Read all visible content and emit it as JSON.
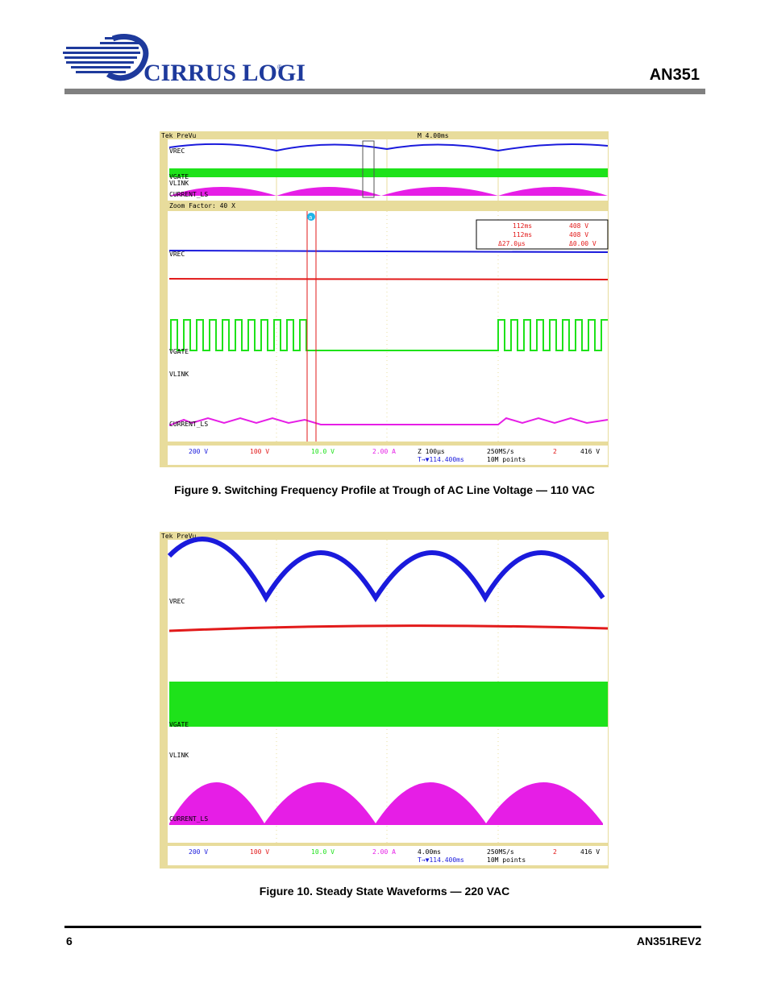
{
  "header": {
    "company": "CIRRUS LOGIC",
    "registered": "®",
    "doc_id": "AN351"
  },
  "figure9": {
    "caption": "Figure 9.  Switching Frequency Profile at Trough of AC Line Voltage — 110 VAC",
    "scope": {
      "top_left": "Tek PreVu",
      "timebase": "M 4.00ms",
      "zoom_factor": "Zoom Factor: 40 X",
      "channels": [
        "VREC",
        "VGATE",
        "VLINK",
        "CURRENT_LS"
      ],
      "cursor_label": "a",
      "readout": {
        "row1": [
          "112ms",
          "408 V"
        ],
        "row2": [
          "112ms",
          "408 V"
        ],
        "row3": [
          "Δ27.0µs",
          "Δ0.00 V"
        ]
      },
      "status": {
        "ch1": "200 V",
        "ch2": "100 V",
        "ch3": "10.0 V",
        "ch4": "2.00 A",
        "zoom": "Z 100µs",
        "delay": "T→▼114.400ms",
        "rate": "250MS/s",
        "points": "10M points",
        "trig_ch": "2",
        "trig_level": "416 V"
      }
    }
  },
  "figure10": {
    "caption": "Figure 10.  Steady State Waveforms — 220 VAC",
    "scope": {
      "top_left": "Tek PreVu",
      "channels": [
        "VREC",
        "VGATE",
        "VLINK",
        "CURRENT_LS"
      ],
      "status": {
        "ch1": "200 V",
        "ch2": "100 V",
        "ch3": "10.0 V",
        "ch4": "2.00 A",
        "timebase": "4.00ms",
        "delay": "T→▼114.400ms",
        "rate": "250MS/s",
        "points": "10M points",
        "trig_ch": "2",
        "trig_level": "416 V"
      }
    }
  },
  "footer": {
    "page_number": "6",
    "doc_rev": "AN351REV2"
  },
  "colors": {
    "vrec": "#1a1adc",
    "vlink": "#e21a1a",
    "vgate": "#1ee21a",
    "current": "#e61ee6",
    "scope_bg": "#ffffff",
    "scope_frame": "#e8dc9c",
    "header_rule": "#808080"
  }
}
